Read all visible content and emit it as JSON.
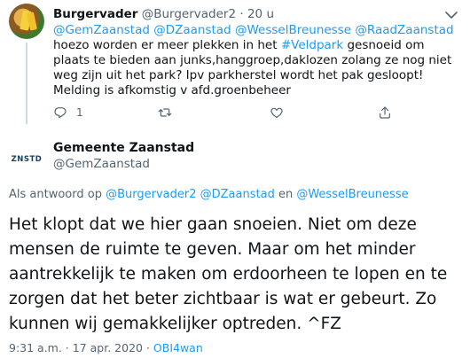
{
  "reply_tweet": {
    "display_name": "Burgervader",
    "handle": "@Burgervader2",
    "separator": "·",
    "time": "20 u",
    "mentions": [
      "@GemZaanstad",
      "@DZaanstad",
      "@WesselBreunesse",
      "@RaadZaanstad"
    ],
    "text_before_hashtag": " hoezo worden er meer plekken in het ",
    "hashtag": "#Veldpark",
    "text_after_hashtag": " gesnoeid om plaats te bieden aan junks,hanggroep,daklozen zolang ze nog niet weg zijn uit het park? Ipv parkherstel wordt het pak gesloopt! Melding is afkomstig v afd.groenbeheer",
    "reply_count": "1"
  },
  "main_tweet": {
    "avatar_text": "ZNSTD",
    "display_name": "Gemeente Zaanstad",
    "handle": "@GemZaanstad",
    "replying_prefix": "Als antwoord op ",
    "replying_to_1": "@Burgervader2",
    "replying_to_2": "@DZaanstad",
    "replying_and": " en ",
    "replying_to_3": "@WesselBreunesse",
    "text": "Het klopt dat we hier gaan snoeien. Niet om deze mensen de ruimte te geven. Maar om het minder aantrekkelijk te maken om erdoorheen te lopen en te zorgen dat het beter zichtbaar is wat er gebeurt. Zo kunnen wij gemakkelijker optreden. ^FZ",
    "time": "9:31 a.m.",
    "separator": " · ",
    "date": "17 apr. 2020",
    "source": "OBI4wan"
  },
  "icons": {
    "reply": "reply-icon",
    "retweet": "retweet-icon",
    "like": "heart-icon",
    "share": "share-icon",
    "more": "chevron-down-icon"
  },
  "colors": {
    "link": "#1d9bf0",
    "secondary_text": "#536471",
    "primary_text": "#0f1419"
  }
}
